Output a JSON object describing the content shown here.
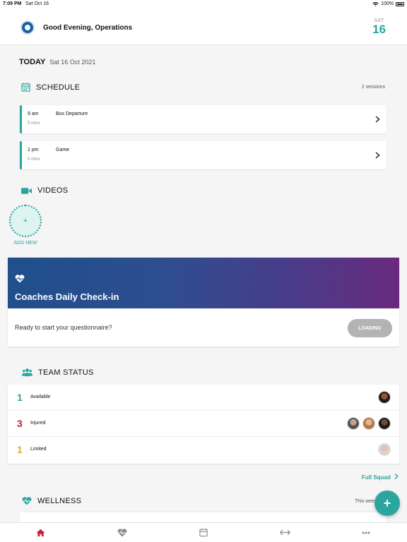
{
  "status_bar": {
    "time": "7:09 PM",
    "date": "Sat Oct 16",
    "battery": "100%"
  },
  "header": {
    "greeting": "Good Evening, Operations",
    "day": "SAT",
    "day_num": "16"
  },
  "today": {
    "label": "TODAY",
    "date": "Sat 16 Oct 2021"
  },
  "schedule": {
    "title": "SCHEDULE",
    "count": "2 sessions",
    "sessions": [
      {
        "time": "9 am",
        "duration": "0 mins",
        "name": "Bus Departure"
      },
      {
        "time": "1 pm",
        "duration": "0 mins",
        "name": "Game"
      }
    ]
  },
  "videos": {
    "title": "VIDEOS",
    "add_symbol": "+",
    "add_label": "ADD NEW"
  },
  "checkin": {
    "title": "Coaches Daily Check-in",
    "prompt": "Ready to start your questionnaire?",
    "button": "LOADING"
  },
  "team_status": {
    "title": "TEAM STATUS",
    "rows": [
      {
        "count": "1",
        "label": "Available",
        "color": "#2aa5a0"
      },
      {
        "count": "3",
        "label": "Injured",
        "color": "#c0243a"
      },
      {
        "count": "1",
        "label": "Limited",
        "color": "#e6a823"
      }
    ],
    "full_squad": "Full Squad"
  },
  "wellness": {
    "title": "WELLNESS",
    "period": "This wee"
  },
  "fab": {
    "label": "+"
  },
  "colors": {
    "accent": "#2aa5a0",
    "tab_active": "#c0243a",
    "tab_inactive": "#8a8a8a"
  },
  "tabs": [
    {
      "icon": "home-icon",
      "active": true
    },
    {
      "icon": "heartbeat-icon",
      "active": false
    },
    {
      "icon": "calendar-icon",
      "active": false
    },
    {
      "icon": "arrows-horizontal-icon",
      "active": false
    },
    {
      "icon": "more-icon",
      "active": false
    }
  ]
}
